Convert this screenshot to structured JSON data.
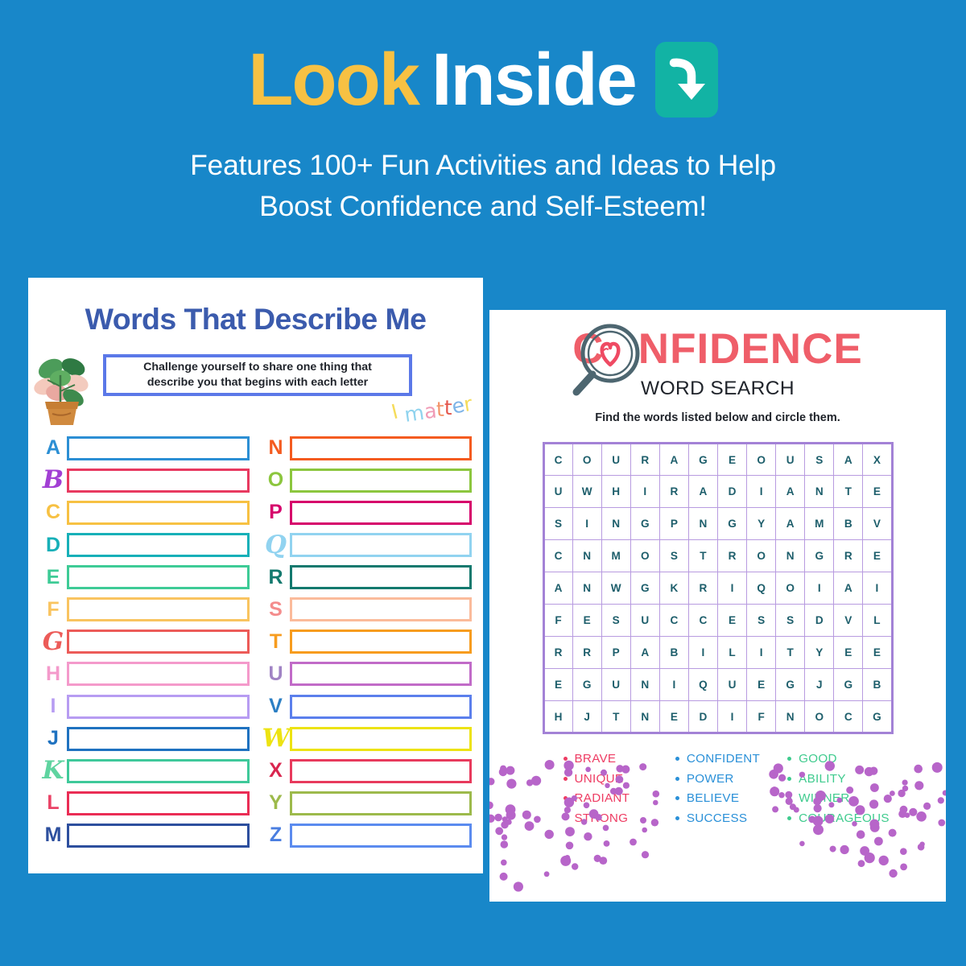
{
  "background_color": "#1887C9",
  "header": {
    "title_part1": "Look",
    "title_part1_color": "#F7C143",
    "title_part2": "Inside",
    "title_part2_color": "#FFFFFF",
    "badge_icon": "curved-down-arrow-icon",
    "badge_color": "#12B3A4",
    "subtitle_line1": "Features 100+ Fun Activities and Ideas to Help",
    "subtitle_line2": "Boost Confidence and Self-Esteem!"
  },
  "left_worksheet": {
    "title": "Words That Describe Me",
    "title_color": "#3B5BAD",
    "plant_icon": "potted-plant-icon",
    "instruction_line1": "Challenge yourself to share one thing that",
    "instruction_line2": "describe you that begins with each letter",
    "instruction_border_color": "#5B78E8",
    "doodle": {
      "letters": [
        {
          "ch": "I",
          "color": "#F5DC5B"
        },
        {
          "ch": " ",
          "color": "#F5DC5B"
        },
        {
          "ch": "m",
          "color": "#8FD3EE"
        },
        {
          "ch": "a",
          "color": "#F09BB6"
        },
        {
          "ch": "t",
          "color": "#F3956B"
        },
        {
          "ch": "t",
          "color": "#E4574D"
        },
        {
          "ch": "e",
          "color": "#7EB4E8"
        },
        {
          "ch": "r",
          "color": "#F5DC5B"
        }
      ]
    },
    "column_left": [
      {
        "letter": "A",
        "letter_color": "#2C8FD4",
        "box_color": "#2C8FD4",
        "script": false
      },
      {
        "letter": "B",
        "letter_color": "#A23FD4",
        "box_color": "#E83A60",
        "script": true
      },
      {
        "letter": "C",
        "letter_color": "#F7C143",
        "box_color": "#F7C143",
        "script": false
      },
      {
        "letter": "D",
        "letter_color": "#17B0B8",
        "box_color": "#17B0B8",
        "script": false
      },
      {
        "letter": "E",
        "letter_color": "#3ECB96",
        "box_color": "#3ECB96",
        "script": false
      },
      {
        "letter": "F",
        "letter_color": "#F9C460",
        "box_color": "#F9C460",
        "script": false
      },
      {
        "letter": "G",
        "letter_color": "#EC5B58",
        "box_color": "#EC5B58",
        "script": true
      },
      {
        "letter": "H",
        "letter_color": "#F49ACB",
        "box_color": "#F49ACB",
        "script": false
      },
      {
        "letter": "I",
        "letter_color": "#B79CF2",
        "box_color": "#B79CF2",
        "script": false
      },
      {
        "letter": "J",
        "letter_color": "#1F72C0",
        "box_color": "#1F72C0",
        "script": false
      },
      {
        "letter": "K",
        "letter_color": "#5FD4A0",
        "box_color": "#3FC99A",
        "script": true
      },
      {
        "letter": "L",
        "letter_color": "#EA4266",
        "box_color": "#EA2D55",
        "script": false
      },
      {
        "letter": "M",
        "letter_color": "#2D4F9E",
        "box_color": "#2D4F9E",
        "script": false
      }
    ],
    "column_right": [
      {
        "letter": "N",
        "letter_color": "#F45B20",
        "box_color": "#F45B20",
        "script": false
      },
      {
        "letter": "O",
        "letter_color": "#8CC63E",
        "box_color": "#8CC63E",
        "script": false
      },
      {
        "letter": "P",
        "letter_color": "#D6006B",
        "box_color": "#D6006B",
        "script": false
      },
      {
        "letter": "Q",
        "letter_color": "#91D3F0",
        "box_color": "#91D3F0",
        "script": true
      },
      {
        "letter": "R",
        "letter_color": "#13796E",
        "box_color": "#13796E",
        "script": false
      },
      {
        "letter": "S",
        "letter_color": "#F48C8C",
        "box_color": "#FBBB9B",
        "script": false
      },
      {
        "letter": "T",
        "letter_color": "#F79C1E",
        "box_color": "#F79C1E",
        "script": false
      },
      {
        "letter": "U",
        "letter_color": "#A083C4",
        "box_color": "#C16BC8",
        "script": false
      },
      {
        "letter": "V",
        "letter_color": "#2C7FC4",
        "box_color": "#5B7FEC",
        "script": false
      },
      {
        "letter": "W",
        "letter_color": "#EDE312",
        "box_color": "#EDE312",
        "script": true
      },
      {
        "letter": "X",
        "letter_color": "#D9264F",
        "box_color": "#E83A5C",
        "script": false
      },
      {
        "letter": "Y",
        "letter_color": "#9DBA4B",
        "box_color": "#9DBA4B",
        "script": false
      },
      {
        "letter": "Z",
        "letter_color": "#4A7EE0",
        "box_color": "#5B8BEF",
        "script": false
      }
    ]
  },
  "right_worksheet": {
    "title": "C NFIDENCE",
    "title_prefix": "C",
    "title_suffix": "NFIDENCE",
    "title_color": "#EF5E69",
    "logo_icon": "magnifier-heart-icon",
    "subtitle": "WORD SEARCH",
    "instruction": "Find the words listed below and circle them.",
    "grid_border_color": "#A382D6",
    "grid_letter_color": "#1D5E6B",
    "grid": [
      [
        "C",
        "O",
        "U",
        "R",
        "A",
        "G",
        "E",
        "O",
        "U",
        "S",
        "A",
        "X"
      ],
      [
        "U",
        "W",
        "H",
        "I",
        "R",
        "A",
        "D",
        "I",
        "A",
        "N",
        "T",
        "E"
      ],
      [
        "S",
        "I",
        "N",
        "G",
        "P",
        "N",
        "G",
        "Y",
        "A",
        "M",
        "B",
        "V"
      ],
      [
        "C",
        "N",
        "M",
        "O",
        "S",
        "T",
        "R",
        "O",
        "N",
        "G",
        "R",
        "E"
      ],
      [
        "A",
        "N",
        "W",
        "G",
        "K",
        "R",
        "I",
        "Q",
        "O",
        "I",
        "A",
        "I"
      ],
      [
        "F",
        "E",
        "S",
        "U",
        "C",
        "C",
        "E",
        "S",
        "S",
        "D",
        "V",
        "L"
      ],
      [
        "R",
        "R",
        "P",
        "A",
        "B",
        "I",
        "L",
        "I",
        "T",
        "Y",
        "E",
        "E"
      ],
      [
        "E",
        "G",
        "U",
        "N",
        "I",
        "Q",
        "U",
        "E",
        "G",
        "J",
        "G",
        "B"
      ],
      [
        "H",
        "J",
        "T",
        "N",
        "E",
        "D",
        "I",
        "F",
        "N",
        "O",
        "C",
        "G"
      ]
    ],
    "word_columns": [
      {
        "color": "#EE3C63",
        "words": [
          "BRAVE",
          "UNIQUE",
          "RADIANT",
          "STRONG"
        ]
      },
      {
        "color": "#2A90D8",
        "words": [
          "CONFIDENT",
          "POWER",
          "BELIEVE",
          "SUCCESS"
        ]
      },
      {
        "color": "#3FCB8E",
        "words": [
          "GOOD",
          "ABILITY",
          "WINNER",
          "COURAGEOUS"
        ]
      }
    ],
    "confetti_color": "#B765C9"
  }
}
